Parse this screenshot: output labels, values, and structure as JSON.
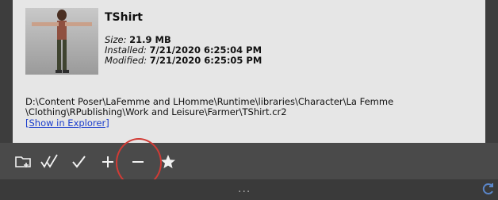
{
  "item": {
    "name": "TShirt",
    "size_label": "Size",
    "size_value": "21.9 MB",
    "installed_label": "Installed",
    "installed_value": "7/21/2020 6:25:04 PM",
    "modified_label": "Modified",
    "modified_value": "7/21/2020 6:25:05 PM",
    "path_line1": "D:\\Content Poser\\LaFemme and LHomme\\Runtime\\libraries\\Character\\La Femme",
    "path_line2": "\\Clothing\\RPublishing\\Work and Leisure\\Farmer\\TShirt.cr2",
    "show_in_explorer": "[Show in Explorer]"
  },
  "toolbar": {
    "buttons": [
      "folder-add-icon",
      "double-check-icon",
      "check-icon",
      "plus-icon",
      "minus-icon",
      "star-icon"
    ]
  },
  "footer": {
    "dots": "...",
    "icon": "refresh-icon"
  },
  "colors": {
    "panel_bg": "#e6e6e6",
    "toolbar_bg": "#4a4a4a",
    "link": "#1a3dcc",
    "highlight": "#d23b35"
  }
}
